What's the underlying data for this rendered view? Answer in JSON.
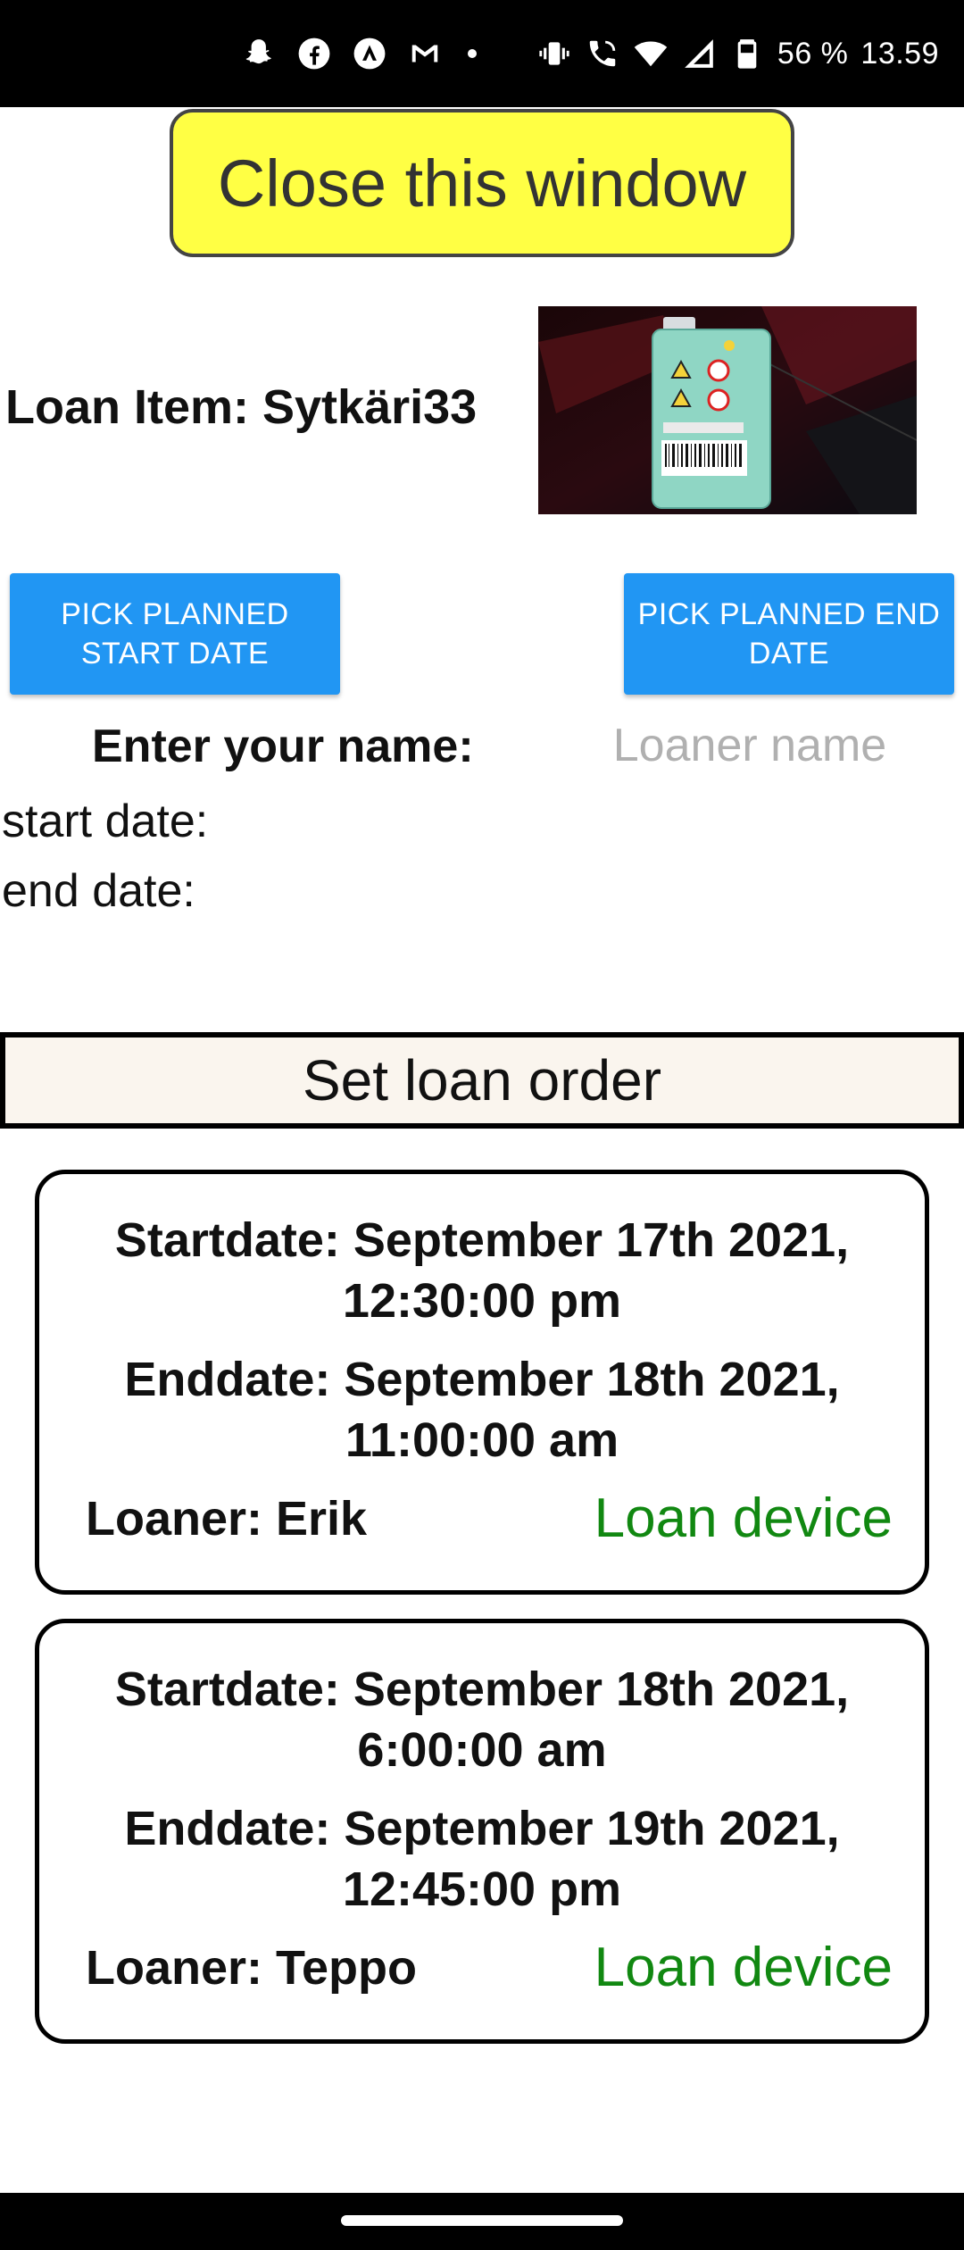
{
  "status_bar": {
    "battery": "56 %",
    "time": "13.59",
    "icons_left": [
      "snapchat-icon",
      "facebook-icon",
      "arc-icon",
      "gmail-icon",
      "notification-dot"
    ],
    "icons_right": [
      "vibrate-icon",
      "wifi-call-icon",
      "wifi-icon",
      "signal-icon",
      "battery-icon"
    ]
  },
  "close_button": {
    "label": "Close this window"
  },
  "loan_item": {
    "title": "Loan Item: Sytkäri33"
  },
  "buttons": {
    "pick_start": "PICK PLANNED START DATE",
    "pick_end": "PICK PLANNED END DATE"
  },
  "form": {
    "name_label": "Enter your name:",
    "name_placeholder": "Loaner name",
    "name_value": "",
    "start_date_label": "start date:",
    "end_date_label": "end date:"
  },
  "set_order": {
    "label": "Set loan order"
  },
  "loans": [
    {
      "start": "Startdate: September 17th 2021, 12:30:00 pm",
      "end": "Enddate: September 18th 2021, 11:00:00 am",
      "loaner": "Loaner: Erik",
      "action": "Loan device"
    },
    {
      "start": "Startdate: September 18th 2021, 6:00:00 am",
      "end": "Enddate: September 19th 2021, 12:45:00 pm",
      "loaner": "Loaner: Teppo",
      "action": "Loan device"
    }
  ],
  "colors": {
    "close_button_bg": "#ffff44",
    "pick_button_bg": "#2196f3",
    "loan_action": "#118811",
    "set_order_bg": "#faf5ee"
  }
}
